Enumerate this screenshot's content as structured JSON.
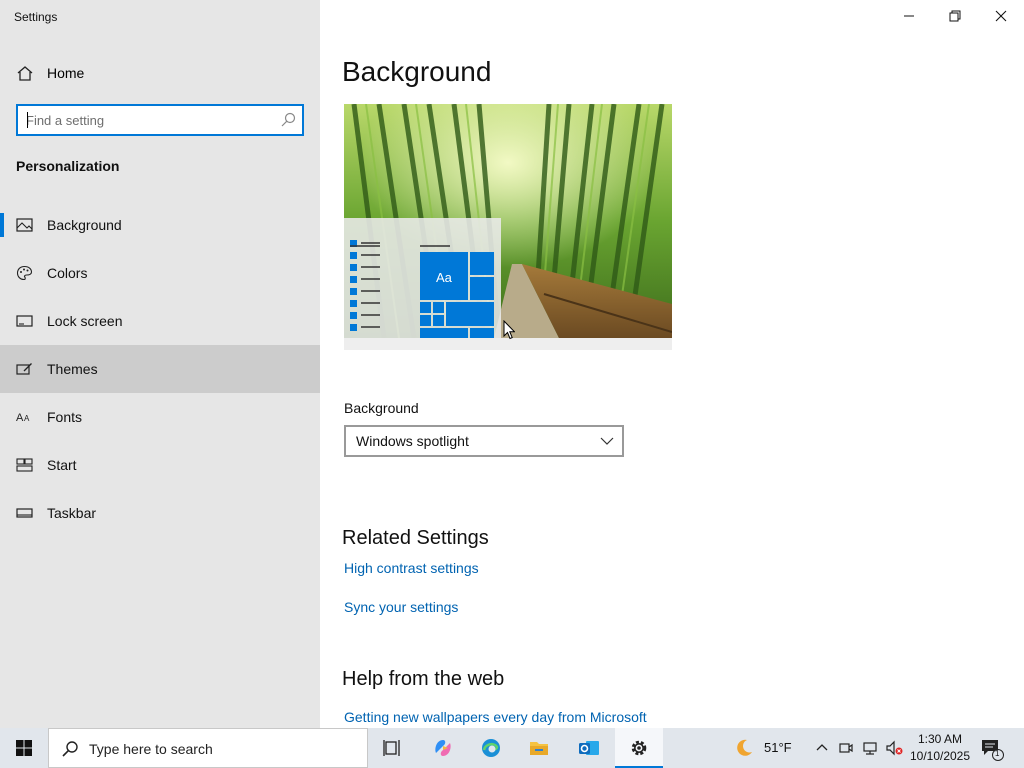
{
  "window": {
    "title": "Settings",
    "controls": {
      "minimize": "minimize-icon",
      "restore": "restore-icon",
      "close": "close-icon"
    }
  },
  "sidebar": {
    "home_label": "Home",
    "search_placeholder": "Find a setting",
    "section_title": "Personalization",
    "items": [
      {
        "label": "Background",
        "icon": "picture-icon",
        "active": true
      },
      {
        "label": "Colors",
        "icon": "palette-icon"
      },
      {
        "label": "Lock screen",
        "icon": "lock-screen-icon"
      },
      {
        "label": "Themes",
        "icon": "themes-icon",
        "hovered": true
      },
      {
        "label": "Fonts",
        "icon": "fonts-icon"
      },
      {
        "label": "Start",
        "icon": "start-icon"
      },
      {
        "label": "Taskbar",
        "icon": "taskbar-icon"
      }
    ]
  },
  "main": {
    "title": "Background",
    "preview_tile_label": "Aa",
    "background_label": "Background",
    "background_value": "Windows spotlight",
    "related_heading": "Related Settings",
    "related_links": [
      "High contrast settings",
      "Sync your settings"
    ],
    "help_heading": "Help from the web",
    "help_links": [
      "Getting new wallpapers every day from Microsoft"
    ]
  },
  "taskbar": {
    "search_placeholder": "Type here to search",
    "apps": [
      "task-view-icon",
      "copilot-icon",
      "edge-icon",
      "file-explorer-icon",
      "outlook-icon",
      "settings-icon"
    ],
    "weather_temp": "51°F",
    "time": "1:30 AM",
    "date": "10/10/2025",
    "notification_count": "1"
  },
  "colors": {
    "accent": "#0078d7",
    "link": "#0063b1",
    "sidebar_bg": "#e6e6e6",
    "hover_bg": "#cccccc"
  }
}
